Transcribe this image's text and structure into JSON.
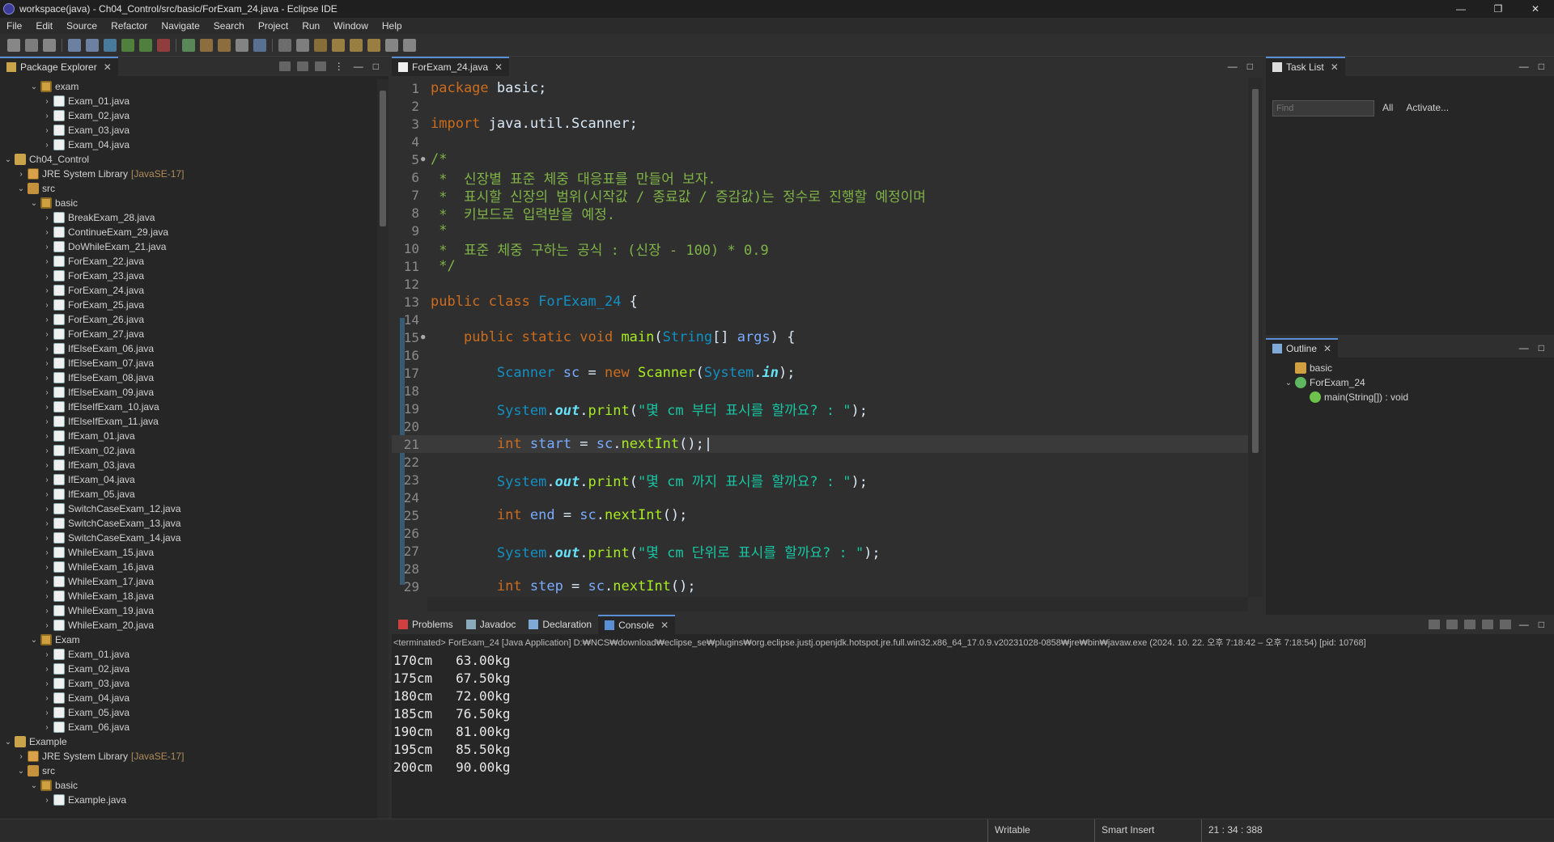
{
  "window": {
    "title": "workspace(java) - Ch04_Control/src/basic/ForExam_24.java - Eclipse IDE",
    "controls": [
      "—",
      "❐",
      "✕"
    ]
  },
  "menu": [
    "File",
    "Edit",
    "Source",
    "Refactor",
    "Navigate",
    "Search",
    "Project",
    "Run",
    "Window",
    "Help"
  ],
  "explorer": {
    "tab": "Package Explorer",
    "rows": [
      {
        "indent": 2,
        "arrow": "⌄",
        "icon": "package",
        "label": "exam"
      },
      {
        "indent": 3,
        "arrow": "›",
        "icon": "java",
        "label": "Exam_01.java"
      },
      {
        "indent": 3,
        "arrow": "›",
        "icon": "java",
        "label": "Exam_02.java"
      },
      {
        "indent": 3,
        "arrow": "›",
        "icon": "java",
        "label": "Exam_03.java"
      },
      {
        "indent": 3,
        "arrow": "›",
        "icon": "java",
        "label": "Exam_04.java"
      },
      {
        "indent": 0,
        "arrow": "⌄",
        "icon": "project",
        "label": "Ch04_Control"
      },
      {
        "indent": 1,
        "arrow": "›",
        "icon": "jre",
        "label": "JRE System Library",
        "extra": "[JavaSE-17]"
      },
      {
        "indent": 1,
        "arrow": "⌄",
        "icon": "src",
        "label": "src"
      },
      {
        "indent": 2,
        "arrow": "⌄",
        "icon": "package",
        "label": "basic"
      },
      {
        "indent": 3,
        "arrow": "›",
        "icon": "java",
        "label": "BreakExam_28.java"
      },
      {
        "indent": 3,
        "arrow": "›",
        "icon": "java",
        "label": "ContinueExam_29.java"
      },
      {
        "indent": 3,
        "arrow": "›",
        "icon": "java",
        "label": "DoWhileExam_21.java"
      },
      {
        "indent": 3,
        "arrow": "›",
        "icon": "java",
        "label": "ForExam_22.java"
      },
      {
        "indent": 3,
        "arrow": "›",
        "icon": "java",
        "label": "ForExam_23.java"
      },
      {
        "indent": 3,
        "arrow": "›",
        "icon": "java",
        "label": "ForExam_24.java"
      },
      {
        "indent": 3,
        "arrow": "›",
        "icon": "java",
        "label": "ForExam_25.java"
      },
      {
        "indent": 3,
        "arrow": "›",
        "icon": "java",
        "label": "ForExam_26.java"
      },
      {
        "indent": 3,
        "arrow": "›",
        "icon": "java",
        "label": "ForExam_27.java"
      },
      {
        "indent": 3,
        "arrow": "›",
        "icon": "java",
        "label": "IfElseExam_06.java"
      },
      {
        "indent": 3,
        "arrow": "›",
        "icon": "java",
        "label": "IfElseExam_07.java"
      },
      {
        "indent": 3,
        "arrow": "›",
        "icon": "java",
        "label": "IfElseExam_08.java"
      },
      {
        "indent": 3,
        "arrow": "›",
        "icon": "java",
        "label": "IfElseExam_09.java"
      },
      {
        "indent": 3,
        "arrow": "›",
        "icon": "java",
        "label": "IfElseIfExam_10.java"
      },
      {
        "indent": 3,
        "arrow": "›",
        "icon": "java",
        "label": "IfElseIfExam_11.java"
      },
      {
        "indent": 3,
        "arrow": "›",
        "icon": "java",
        "label": "IfExam_01.java"
      },
      {
        "indent": 3,
        "arrow": "›",
        "icon": "java",
        "label": "IfExam_02.java"
      },
      {
        "indent": 3,
        "arrow": "›",
        "icon": "java",
        "label": "IfExam_03.java"
      },
      {
        "indent": 3,
        "arrow": "›",
        "icon": "java",
        "label": "IfExam_04.java"
      },
      {
        "indent": 3,
        "arrow": "›",
        "icon": "java",
        "label": "IfExam_05.java"
      },
      {
        "indent": 3,
        "arrow": "›",
        "icon": "java",
        "label": "SwitchCaseExam_12.java"
      },
      {
        "indent": 3,
        "arrow": "›",
        "icon": "java",
        "label": "SwitchCaseExam_13.java"
      },
      {
        "indent": 3,
        "arrow": "›",
        "icon": "java",
        "label": "SwitchCaseExam_14.java"
      },
      {
        "indent": 3,
        "arrow": "›",
        "icon": "java",
        "label": "WhileExam_15.java"
      },
      {
        "indent": 3,
        "arrow": "›",
        "icon": "java",
        "label": "WhileExam_16.java"
      },
      {
        "indent": 3,
        "arrow": "›",
        "icon": "java",
        "label": "WhileExam_17.java"
      },
      {
        "indent": 3,
        "arrow": "›",
        "icon": "java",
        "label": "WhileExam_18.java"
      },
      {
        "indent": 3,
        "arrow": "›",
        "icon": "java",
        "label": "WhileExam_19.java"
      },
      {
        "indent": 3,
        "arrow": "›",
        "icon": "java",
        "label": "WhileExam_20.java"
      },
      {
        "indent": 2,
        "arrow": "⌄",
        "icon": "package",
        "label": "Exam"
      },
      {
        "indent": 3,
        "arrow": "›",
        "icon": "java",
        "label": "Exam_01.java"
      },
      {
        "indent": 3,
        "arrow": "›",
        "icon": "java",
        "label": "Exam_02.java"
      },
      {
        "indent": 3,
        "arrow": "›",
        "icon": "java",
        "label": "Exam_03.java"
      },
      {
        "indent": 3,
        "arrow": "›",
        "icon": "java",
        "label": "Exam_04.java"
      },
      {
        "indent": 3,
        "arrow": "›",
        "icon": "java",
        "label": "Exam_05.java"
      },
      {
        "indent": 3,
        "arrow": "›",
        "icon": "java",
        "label": "Exam_06.java"
      },
      {
        "indent": 0,
        "arrow": "⌄",
        "icon": "project",
        "label": "Example"
      },
      {
        "indent": 1,
        "arrow": "›",
        "icon": "jre",
        "label": "JRE System Library",
        "extra": "[JavaSE-17]"
      },
      {
        "indent": 1,
        "arrow": "⌄",
        "icon": "src",
        "label": "src"
      },
      {
        "indent": 2,
        "arrow": "⌄",
        "icon": "package",
        "label": "basic"
      },
      {
        "indent": 3,
        "arrow": "›",
        "icon": "java",
        "label": "Example.java"
      }
    ]
  },
  "editor": {
    "tab": "ForExam_24.java",
    "current_line": 21,
    "lines": [
      {
        "n": "1",
        "fold": "",
        "html": "<span class='kw'>package</span> basic;"
      },
      {
        "n": "2",
        "fold": "",
        "html": ""
      },
      {
        "n": "3",
        "fold": "",
        "html": "<span class='kw'>import</span> java.util.Scanner;"
      },
      {
        "n": "4",
        "fold": "",
        "html": ""
      },
      {
        "n": "5",
        "fold": "●",
        "html": "<span class='cm'>/*</span>"
      },
      {
        "n": "6",
        "fold": "",
        "html": "<span class='cm'> *  신장별 표준 체중 대응표를 만들어 보자.</span>"
      },
      {
        "n": "7",
        "fold": "",
        "html": "<span class='cm'> *  표시할 신장의 범위(시작값 / 종료값 / 증감값)는 정수로 진행할 예정이며</span>"
      },
      {
        "n": "8",
        "fold": "",
        "html": "<span class='cm'> *  키보드로 입력받을 예정.</span>"
      },
      {
        "n": "9",
        "fold": "",
        "html": "<span class='cm'> *</span>"
      },
      {
        "n": "10",
        "fold": "",
        "html": "<span class='cm'> *  표준 체중 구하는 공식 : (신장 - 100) * 0.9</span>"
      },
      {
        "n": "11",
        "fold": "",
        "html": "<span class='cm'> */</span>"
      },
      {
        "n": "12",
        "fold": "",
        "html": ""
      },
      {
        "n": "13",
        "fold": "",
        "html": "<span class='kw'>public class</span> <span class='cls'>ForExam_24</span> {"
      },
      {
        "n": "14",
        "fold": "",
        "html": ""
      },
      {
        "n": "15",
        "fold": "●",
        "html": "    <span class='kw'>public static void</span> <span class='mth'>main</span>(<span class='typ'>String</span>[] <span class='var'>args</span>) {"
      },
      {
        "n": "16",
        "fold": "",
        "html": ""
      },
      {
        "n": "17",
        "fold": "",
        "html": "        <span class='typ'>Scanner</span> <span class='var'>sc</span> = <span class='kw'>new</span> <span class='mth'>Scanner</span>(<span class='typ'>System</span>.<span class='fld'>in</span>);"
      },
      {
        "n": "18",
        "fold": "",
        "html": ""
      },
      {
        "n": "19",
        "fold": "",
        "html": "        <span class='typ'>System</span>.<span class='fld'>out</span>.<span class='mth'>print</span>(<span class='str'>\"몇 cm 부터 표시를 할까요? : \"</span>);"
      },
      {
        "n": "20",
        "fold": "",
        "html": ""
      },
      {
        "n": "21",
        "fold": "",
        "html": "        <span class='kw'>int</span> <span class='var'>start</span> = <span class='var'>sc</span>.<span class='mth'>nextInt</span>();|"
      },
      {
        "n": "22",
        "fold": "",
        "html": ""
      },
      {
        "n": "23",
        "fold": "",
        "html": "        <span class='typ'>System</span>.<span class='fld'>out</span>.<span class='mth'>print</span>(<span class='str'>\"몇 cm 까지 표시를 할까요? : \"</span>);"
      },
      {
        "n": "24",
        "fold": "",
        "html": ""
      },
      {
        "n": "25",
        "fold": "",
        "html": "        <span class='kw'>int</span> <span class='var'>end</span> = <span class='var'>sc</span>.<span class='mth'>nextInt</span>();"
      },
      {
        "n": "26",
        "fold": "",
        "html": ""
      },
      {
        "n": "27",
        "fold": "",
        "html": "        <span class='typ'>System</span>.<span class='fld'>out</span>.<span class='mth'>print</span>(<span class='str'>\"몇 cm 단위로 표시를 할까요? : \"</span>);"
      },
      {
        "n": "28",
        "fold": "",
        "html": ""
      },
      {
        "n": "29",
        "fold": "",
        "html": "        <span class='kw'>int</span> <span class='var'>step</span> = <span class='var'>sc</span>.<span class='mth'>nextInt</span>();"
      }
    ]
  },
  "tasklist": {
    "tab": "Task List",
    "find_placeholder": "Find",
    "all": "All",
    "activate": "Activate..."
  },
  "outline": {
    "tab": "Outline",
    "items": [
      {
        "indent": 0,
        "arrow": "",
        "icon": "package",
        "label": "basic"
      },
      {
        "indent": 0,
        "arrow": "⌄",
        "icon": "class",
        "label": "ForExam_24"
      },
      {
        "indent": 1,
        "arrow": "",
        "icon": "method",
        "label": "main(String[]) : void"
      }
    ]
  },
  "console": {
    "tabs": [
      {
        "label": "Problems",
        "active": false
      },
      {
        "label": "Javadoc",
        "active": false
      },
      {
        "label": "Declaration",
        "active": false
      },
      {
        "label": "Console",
        "active": true
      }
    ],
    "info": "<terminated> ForExam_24 [Java Application] D:₩NCS₩download₩eclipse_se₩plugins₩org.eclipse.justj.openjdk.hotspot.jre.full.win32.x86_64_17.0.9.v20231028-0858₩jre₩bin₩javaw.exe  (2024. 10. 22. 오후 7:18:42 – 오후 7:18:54) [pid: 10768]",
    "output": [
      "170cm   63.00kg",
      "175cm   67.50kg",
      "180cm   72.00kg",
      "185cm   76.50kg",
      "190cm   81.00kg",
      "195cm   85.50kg",
      "200cm   90.00kg"
    ]
  },
  "status": {
    "writable": "Writable",
    "insert_mode": "Smart Insert",
    "position": "21 : 34 : 388"
  }
}
